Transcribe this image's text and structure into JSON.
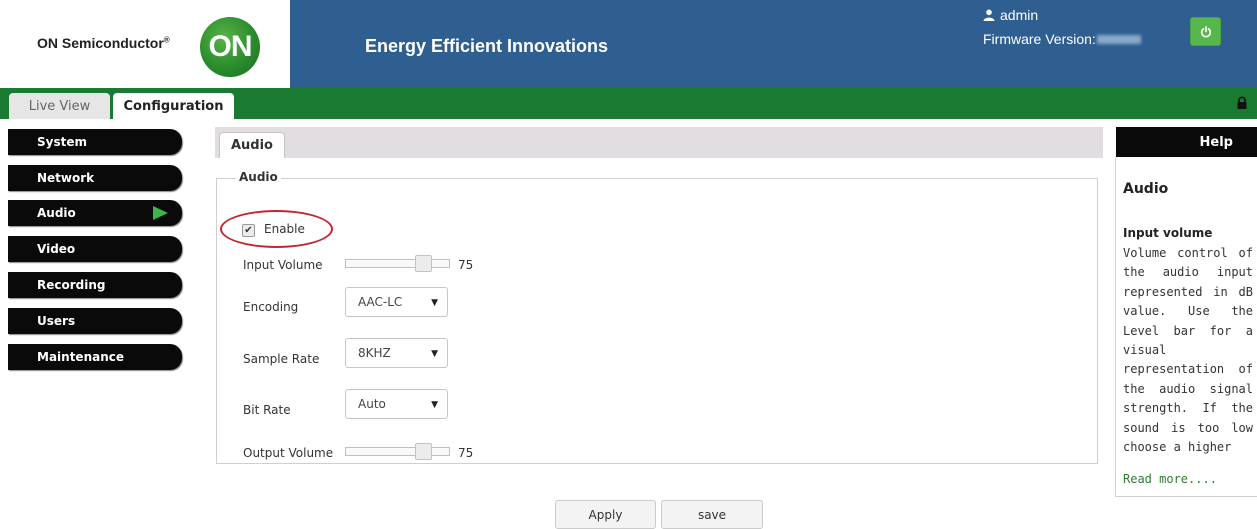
{
  "header": {
    "brand": "ON Semiconductor",
    "brand_mark": "®",
    "logo_text": "ON",
    "tagline": "Energy Efficient Innovations",
    "user": "admin",
    "firmware_label": "Firmware Version:",
    "power_icon": "power-icon"
  },
  "top_tabs": [
    {
      "label": "Live View",
      "active": false
    },
    {
      "label": "Configuration",
      "active": true
    }
  ],
  "nav": {
    "items": [
      {
        "label": "System"
      },
      {
        "label": "Network"
      },
      {
        "label": "Audio",
        "active": true
      },
      {
        "label": "Video"
      },
      {
        "label": "Recording"
      },
      {
        "label": "Users"
      },
      {
        "label": "Maintenance"
      }
    ]
  },
  "content": {
    "tab": "Audio",
    "section_title": "Audio",
    "enable": {
      "label": "Enable",
      "checked": true
    },
    "input_volume": {
      "label": "Input Volume",
      "value": "75",
      "level": 0.75
    },
    "encoding": {
      "label": "Encoding",
      "value": "AAC-LC"
    },
    "sample_rate": {
      "label": "Sample Rate",
      "value": "8KHZ"
    },
    "bit_rate": {
      "label": "Bit Rate",
      "value": "Auto"
    },
    "output_volume": {
      "label": "Output Volume",
      "value": "75",
      "level": 0.75
    },
    "apply_label": "Apply",
    "save_label": "save"
  },
  "help": {
    "header": "Help",
    "title": "Audio",
    "subtitle": "Input volume",
    "text": "Volume control of the audio input represented in dB value. Use the Level bar for a visual representation of the audio signal strength. If the sound is too low choose a higher",
    "read_more": "Read more...."
  },
  "colors": {
    "header_blue": "#2f5e91",
    "tab_bar_green": "#1b7a32",
    "nav_black": "#0a0a0a",
    "active_arrow_green": "#3cb54a",
    "highlight_red": "#c2272d"
  }
}
